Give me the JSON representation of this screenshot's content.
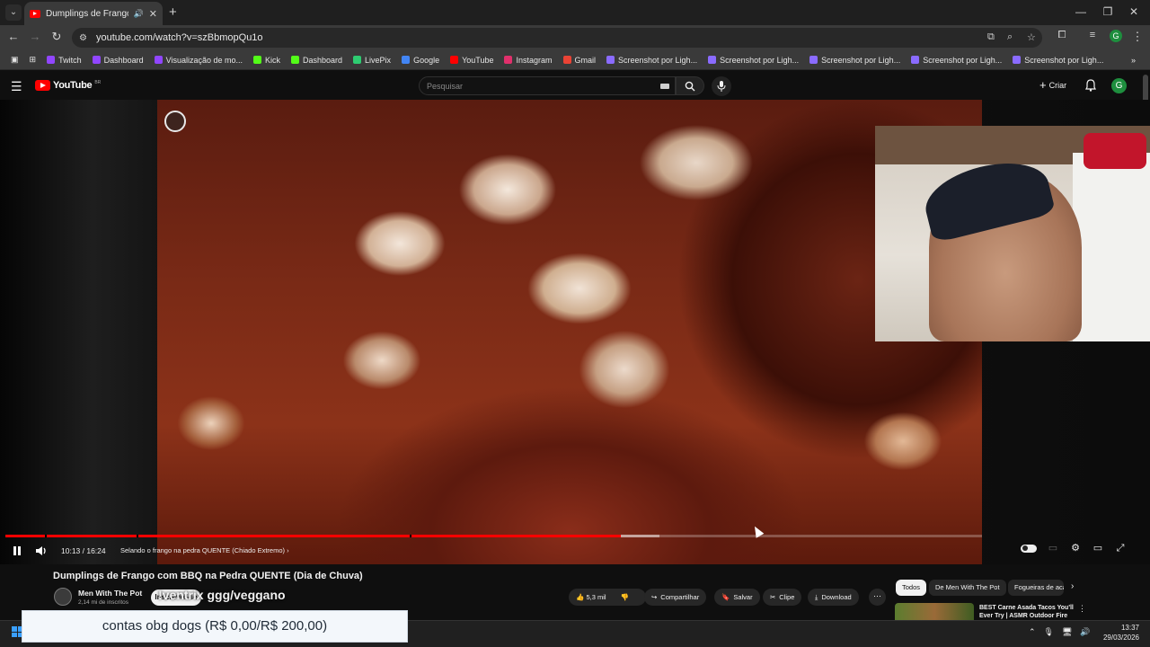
{
  "browser": {
    "tab_title": "Dumplings de Frango com BBQ na Pedra QUENTE (Dia de Chuva)",
    "url": "youtube.com/watch?v=szBbmopQu1o",
    "profile_initial": "G",
    "bookmarks": [
      "Twitch",
      "Dashboard",
      "Visualização de mo...",
      "Kick",
      "Dashboard",
      "LivePix",
      "Google",
      "YouTube",
      "Instagram",
      "Gmail",
      "Screenshot por Ligh...",
      "Screenshot por Ligh...",
      "Screenshot por Ligh...",
      "Screenshot por Ligh...",
      "Screenshot por Ligh..."
    ],
    "bookmark_colors": [
      "#9146ff",
      "#9146ff",
      "#9146ff",
      "#53fc18",
      "#53fc18",
      "#2ecc71",
      "#4285f4",
      "#ff0000",
      "#e1306c",
      "#ea4335",
      "#8a6bff",
      "#8a6bff",
      "#8a6bff",
      "#8a6bff",
      "#8a6bff"
    ]
  },
  "youtube": {
    "logo_text": "YouTube",
    "logo_country": "BR",
    "search_placeholder": "Pesquisar",
    "create_label": "Criar",
    "avatar_initial": "G"
  },
  "player": {
    "time": "10:13 / 16:24",
    "chapter": "Selando o frango na pedra QUENTE (Chiado Extremo)",
    "progress": 0.63,
    "buffered": 0.67
  },
  "video": {
    "title": "Dumplings de Frango com BBQ na Pedra QUENTE (Dia de Chuva)",
    "channel": "Men With The Pot",
    "subscribers": "2,14 mi de inscritos",
    "subscribe_label": "Inscrever-se",
    "overlay_text": "!ventrix ggg/veggano",
    "likes": "5,3 mil",
    "share_label": "Compartilhar",
    "save_label": "Salvar",
    "clip_label": "Clipe",
    "download_label": "Download"
  },
  "chips": [
    "Todos",
    "De Men With The Pot",
    "Fogueiras de acampamento"
  ],
  "recommendation": {
    "title": "BEST Carne Asada Tacos You'll Ever Try | ASMR Outdoor Fire"
  },
  "goal_overlay": "contas obg dogs (R$ 0,00/R$ 200,00)",
  "taskbar": {
    "time": "13:37",
    "date": "29/03/2026"
  }
}
